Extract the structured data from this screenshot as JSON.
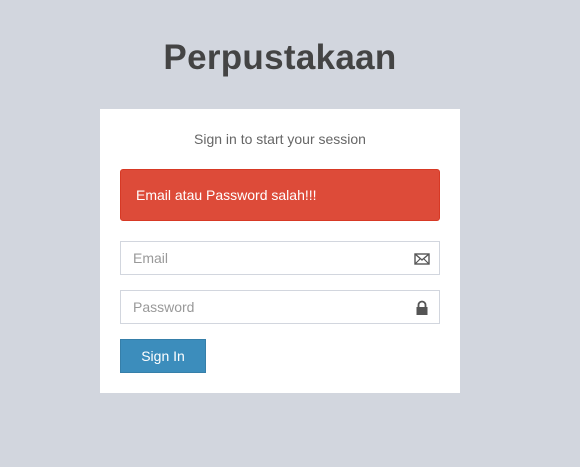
{
  "app": {
    "title": "Perpustakaan"
  },
  "login": {
    "message": "Sign in to start your session",
    "alert_text": "Email atau Password salah!!!",
    "email": {
      "placeholder": "Email",
      "value": "",
      "icon": "envelope-icon"
    },
    "password": {
      "placeholder": "Password",
      "value": "",
      "icon": "lock-icon"
    },
    "submit_label": "Sign In"
  },
  "colors": {
    "background": "#d2d6de",
    "alert": "#dd4b39",
    "primary_button": "#3c8dbc",
    "title_text": "#444444"
  }
}
